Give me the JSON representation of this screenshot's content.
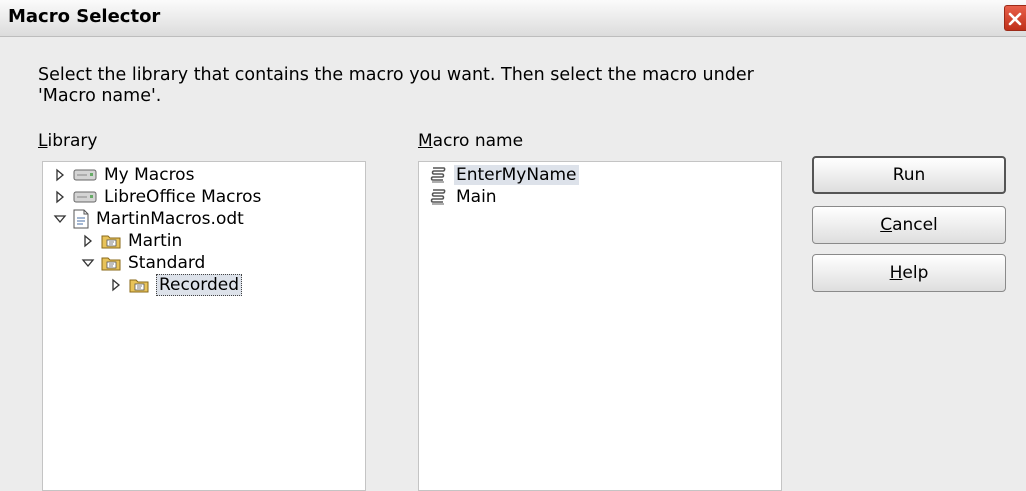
{
  "window": {
    "title": "Macro Selector"
  },
  "instruction": "Select the library that contains the macro you want. Then select the macro under 'Macro name'.",
  "library": {
    "label_ul": "L",
    "label_rest": "ibrary",
    "items": [
      {
        "label": "My Macros",
        "icon": "drive-icon",
        "expander": "collapsed"
      },
      {
        "label": "LibreOffice Macros",
        "icon": "drive-icon",
        "expander": "collapsed"
      },
      {
        "label": "MartinMacros.odt",
        "icon": "document-icon",
        "expander": "expanded"
      },
      {
        "label": "Martin",
        "icon": "library-folder-icon",
        "expander": "collapsed"
      },
      {
        "label": "Standard",
        "icon": "library-folder-icon",
        "expander": "expanded"
      },
      {
        "label": "Recorded",
        "icon": "library-folder-icon",
        "expander": "collapsed",
        "selected": true
      }
    ]
  },
  "macro_name": {
    "label_ul": "M",
    "label_rest": "acro name",
    "items": [
      {
        "label": "EnterMyName",
        "icon": "macro-icon",
        "selected": true
      },
      {
        "label": "Main",
        "icon": "macro-icon"
      }
    ]
  },
  "buttons": {
    "run": "Run",
    "cancel_ul": "C",
    "cancel_rest": "ancel",
    "help_ul": "H",
    "help_rest": "elp"
  },
  "colors": {
    "selection": "#dde2ea",
    "close_button": "#d2402a",
    "folder": "#e8c35a"
  }
}
